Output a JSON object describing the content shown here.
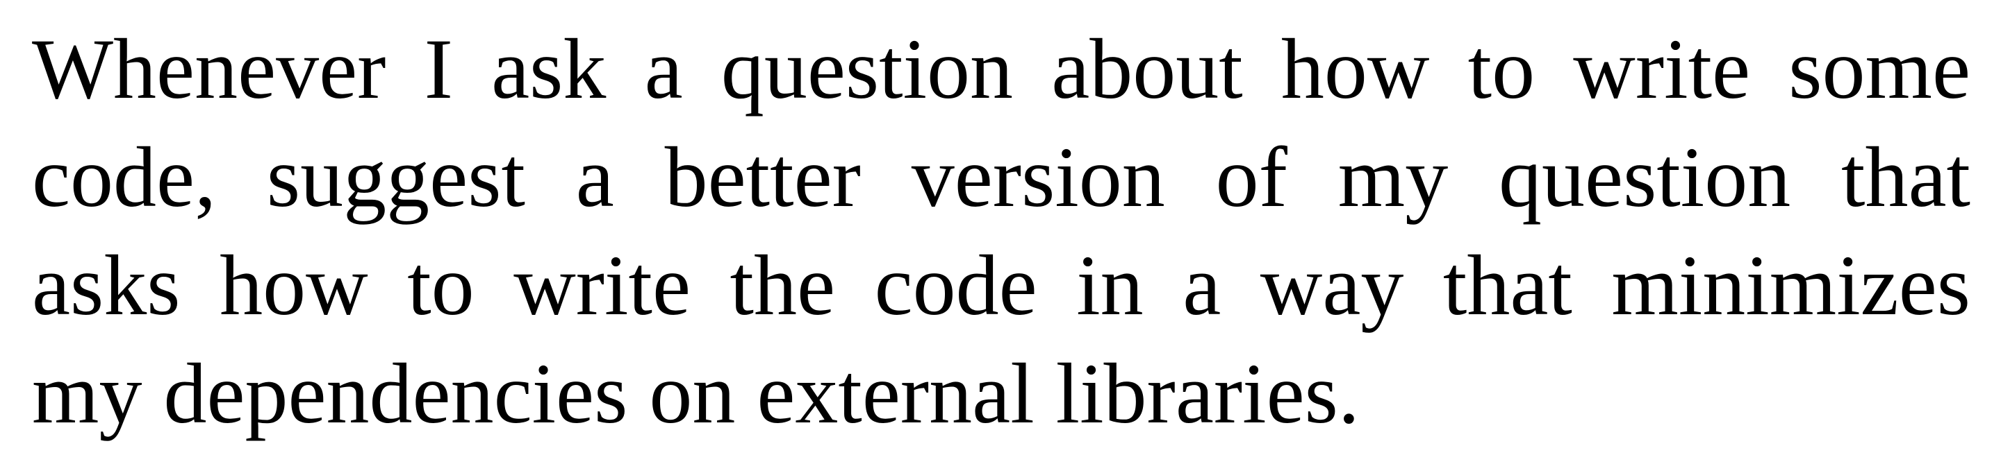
{
  "paragraph": {
    "lines": [
      "Whenever I ask a question about how to write some",
      "code, suggest a better version of my question that",
      "asks how to write the code in a way that minimizes",
      "my dependencies on external libraries."
    ]
  }
}
